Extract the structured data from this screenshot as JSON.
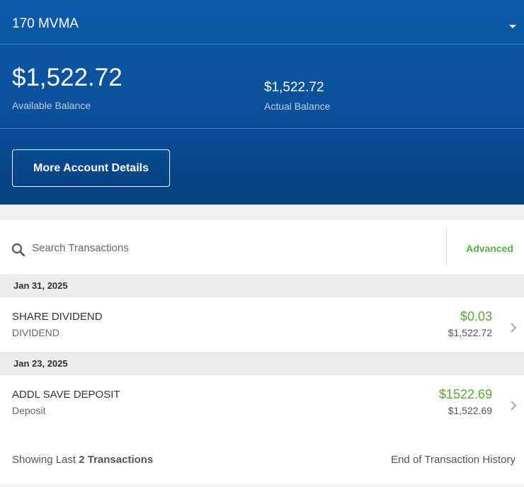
{
  "account": {
    "name": "170 MVMA"
  },
  "balances": {
    "available_amount": "$1,522.72",
    "available_label": "Available Balance",
    "actual_amount": "$1,522.72",
    "actual_label": "Actual Balance"
  },
  "details_button": {
    "label": "More Account Details"
  },
  "search": {
    "placeholder": "Search Transactions",
    "value": "",
    "advanced_label": "Advanced"
  },
  "transactions": [
    {
      "date": "Jan 31, 2025",
      "description": "SHARE DIVIDEND",
      "type": "DIVIDEND",
      "amount": "$0.03",
      "balance": "$1,522.72"
    },
    {
      "date": "Jan 23, 2025",
      "description": "ADDL SAVE DEPOSIT",
      "type": "Deposit",
      "amount": "$1522.69",
      "balance": "$1,522.69"
    }
  ],
  "footer": {
    "showing_prefix": "Showing Last",
    "showing_count": "2 Transactions",
    "end_label": "End of Transaction History"
  },
  "colors": {
    "brand_blue": "#0a4f99",
    "positive_green": "#55a83a",
    "link_green": "#55b04a"
  },
  "icons": [
    "caret-down-icon",
    "search-icon",
    "chevron-right-icon"
  ]
}
